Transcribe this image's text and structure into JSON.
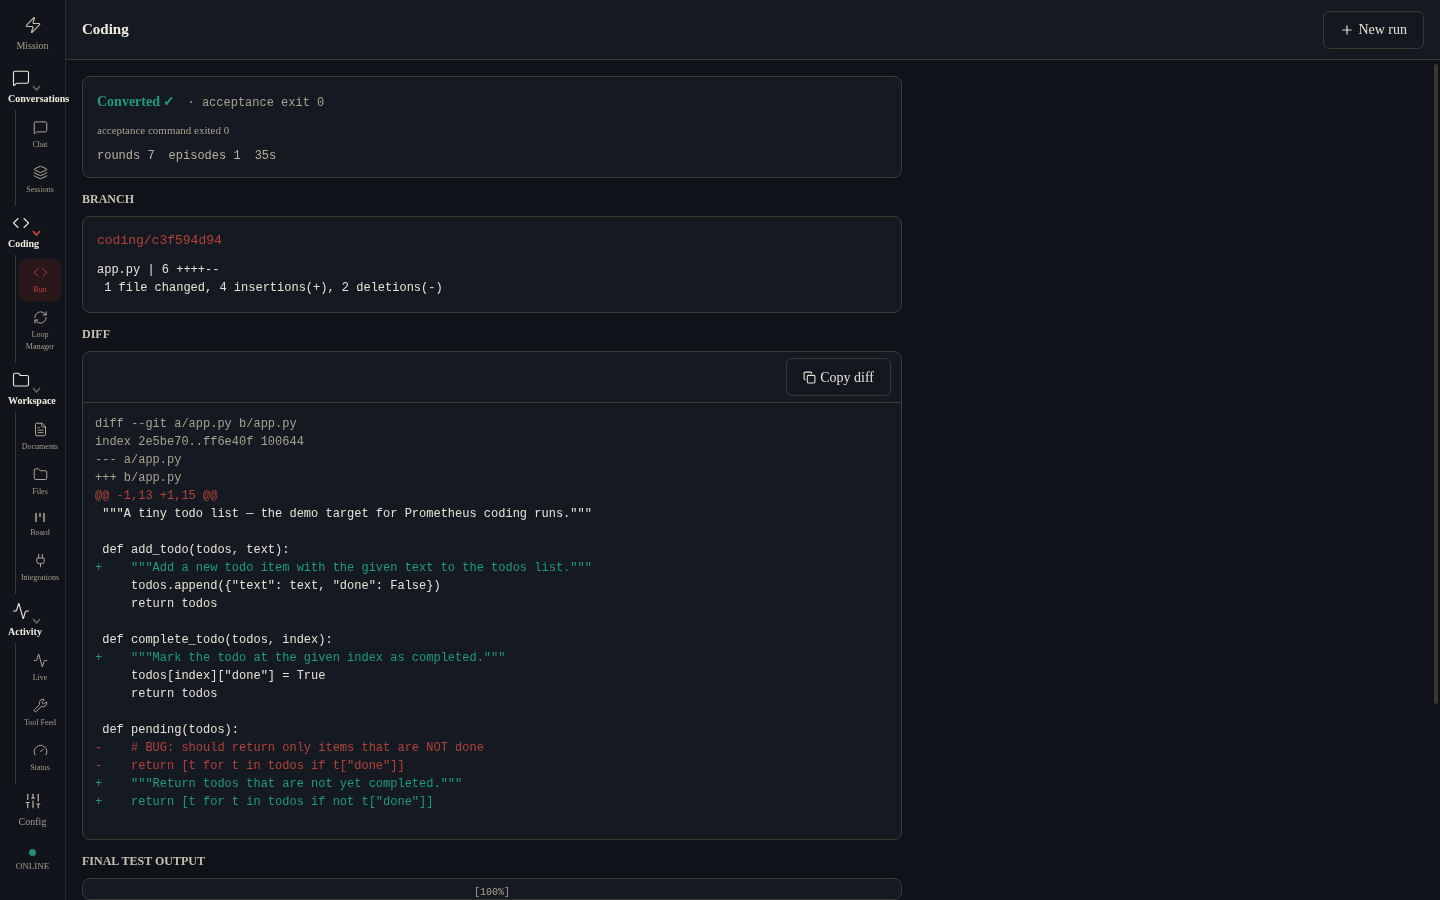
{
  "sidebar": {
    "items": [
      {
        "kind": "link",
        "label": "Mission"
      },
      {
        "kind": "group",
        "label": "Conversations",
        "expanded": true,
        "selected": false,
        "children": [
          {
            "label": "Chat",
            "selected": false
          },
          {
            "label": "Sessions",
            "selected": false
          }
        ]
      },
      {
        "kind": "group",
        "label": "Coding",
        "expanded": true,
        "selected": true,
        "children": [
          {
            "label": "Run",
            "selected": true
          },
          {
            "label": "Loop Manager",
            "selected": false
          }
        ]
      },
      {
        "kind": "group",
        "label": "Workspace",
        "expanded": true,
        "selected": false,
        "children": [
          {
            "label": "Documents",
            "selected": false
          },
          {
            "label": "Files",
            "selected": false
          },
          {
            "label": "Board",
            "selected": false
          },
          {
            "label": "Integrations",
            "selected": false
          }
        ]
      },
      {
        "kind": "group",
        "label": "Activity",
        "expanded": true,
        "selected": false,
        "children": [
          {
            "label": "Live",
            "selected": false
          },
          {
            "label": "Tool Feed",
            "selected": false
          },
          {
            "label": "Status",
            "selected": false
          }
        ]
      },
      {
        "kind": "link",
        "label": "Config"
      }
    ],
    "status": {
      "label": "ONLINE",
      "color": "#1f8f74"
    }
  },
  "header": {
    "title": "Coding",
    "button": "New run"
  },
  "result": {
    "status": "Converted ✓",
    "status_detail": "· acceptance exit 0",
    "message": "acceptance command exited 0",
    "stats": [
      "rounds 7",
      "episodes 1",
      "35s"
    ]
  },
  "branch": {
    "heading": "BRANCH",
    "name": "coding/c3f594d94",
    "stat_lines": [
      "app.py | 6 ++++--",
      " 1 file changed, 4 insertions(+), 2 deletions(-)"
    ]
  },
  "diff": {
    "heading": "DIFF",
    "button": "Copy diff",
    "lines": [
      {
        "kind": "meta",
        "text": "diff --git a/app.py b/app.py"
      },
      {
        "kind": "meta",
        "text": "index 2e5be70..ff6e40f 100644"
      },
      {
        "kind": "meta",
        "text": "--- a/app.py"
      },
      {
        "kind": "meta",
        "text": "+++ b/app.py"
      },
      {
        "kind": "hunk",
        "text": "@@ -1,13 +1,15 @@"
      },
      {
        "kind": "context",
        "text": " \"\"\"A tiny todo list — the demo target for Prometheus coding runs.\"\"\""
      },
      {
        "kind": "blank"
      },
      {
        "kind": "context",
        "text": " def add_todo(todos, text):"
      },
      {
        "kind": "add",
        "text": "+    \"\"\"Add a new todo item with the given text to the todos list.\"\"\""
      },
      {
        "kind": "context",
        "text": "     todos.append({\"text\": text, \"done\": False})"
      },
      {
        "kind": "context",
        "text": "     return todos"
      },
      {
        "kind": "blank"
      },
      {
        "kind": "context",
        "text": " def complete_todo(todos, index):"
      },
      {
        "kind": "add",
        "text": "+    \"\"\"Mark the todo at the given index as completed.\"\"\""
      },
      {
        "kind": "context",
        "text": "     todos[index][\"done\"] = True"
      },
      {
        "kind": "context",
        "text": "     return todos"
      },
      {
        "kind": "blank"
      },
      {
        "kind": "context",
        "text": " def pending(todos):"
      },
      {
        "kind": "del",
        "text": "-    # BUG: should return only items that are NOT done"
      },
      {
        "kind": "del",
        "text": "-    return [t for t in todos if t[\"done\"]]"
      },
      {
        "kind": "add",
        "text": "+    \"\"\"Return todos that are not yet completed.\"\"\""
      },
      {
        "kind": "add",
        "text": "+    return [t for t in todos if not t[\"done\"]]"
      }
    ]
  },
  "final_test_output": {
    "heading": "FINAL TEST OUTPUT",
    "text": "[100%]"
  }
}
